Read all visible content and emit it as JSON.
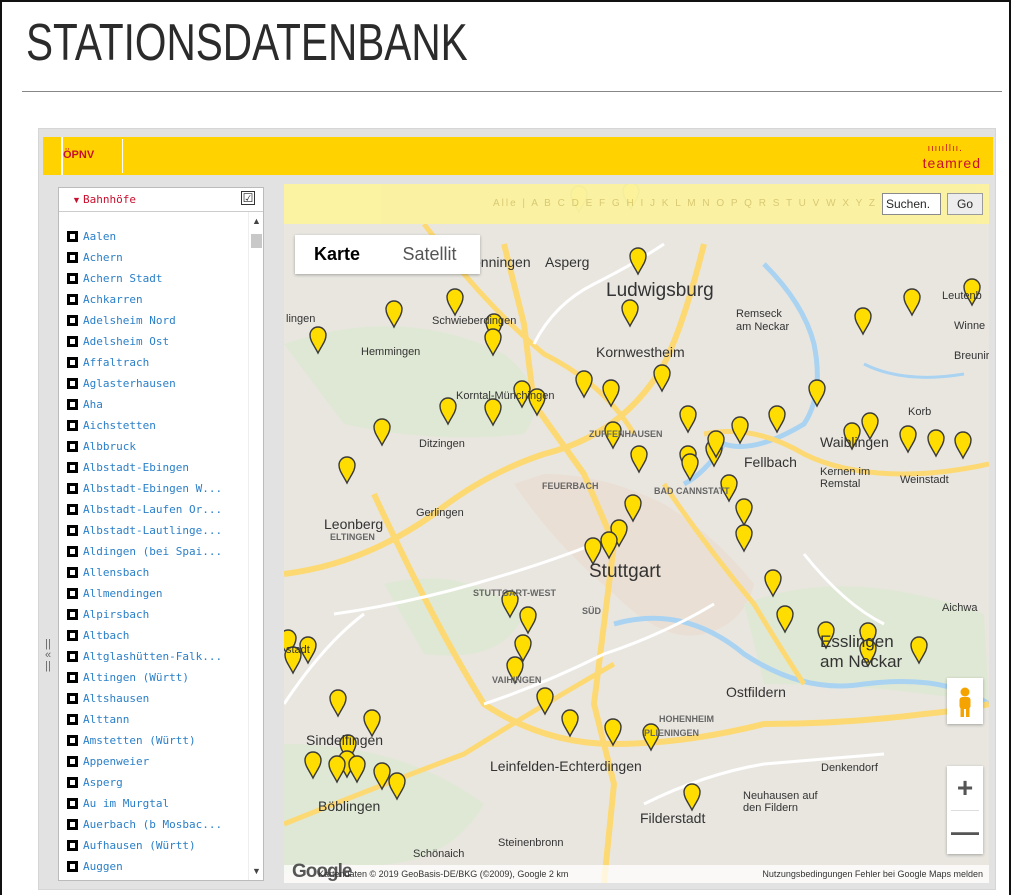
{
  "page": {
    "title": "STATIONSDATENBANK"
  },
  "topbar": {
    "tab_label": "ÖPNV",
    "logo_wave": "ıııııllıı.",
    "logo_brand": "teamred"
  },
  "sidebar": {
    "dropdown_label": "Bahnhöfe",
    "checkbox": "☑",
    "collapse": "||\n«\n||",
    "items": [
      "Aalen",
      "Achern",
      "Achern Stadt",
      "Achkarren",
      "Adelsheim Nord",
      "Adelsheim Ost",
      "Affaltrach",
      "Aglasterhausen",
      "Aha",
      "Aichstetten",
      "Albbruck",
      "Albstadt-Ebingen",
      "Albstadt-Ebingen W...",
      "Albstadt-Laufen Or...",
      "Albstadt-Lautlinge...",
      "Aldingen (bei Spai...",
      "Allensbach",
      "Allmendingen",
      "Alpirsbach",
      "Altbach",
      "Altglashütten-Falk...",
      "Altingen (Württ)",
      "Altshausen",
      "Alttann",
      "Amstetten (Württ)",
      "Appenweier",
      "Asperg",
      "Au im Murgtal",
      "Auerbach (b Mosbac...",
      "Aufhausen (Württ)",
      "Auggen"
    ]
  },
  "filter": {
    "alphabet": "Alle | A B C D E F G H I J K L M N O P Q R S T U V W X Y Z",
    "search_value": "Suchen.",
    "go_label": "Go"
  },
  "map": {
    "type_map": "Karte",
    "type_satellite": "Satellit",
    "zoom_in": "+",
    "zoom_out": "—",
    "google": "Google",
    "copyright": "Kartendaten © 2019 GeoBasis-DE/BKG (©2009), Google   2 km",
    "terms": "Nutzungsbedingungen   Fehler bei Google Maps melden",
    "places": {
      "ludwigsburg": "Ludwigsburg",
      "asperg": "Asperg",
      "boeningen": "önningen",
      "schwieberdingen": "Schwieberdingen",
      "hemmingen": "Hemmingen",
      "kornwestheim": "Kornwestheim",
      "remseck": "Remseck\nam Neckar",
      "korntal": "Korntal-Münchingen",
      "leutenb": "Leutenb",
      "winne": "Winne",
      "breunin": "Breunir",
      "korb": "Korb",
      "waiblingen": "Waiblingen",
      "fellbach": "Fellbach",
      "kernen": "Kernen im\nRemstal",
      "weinstadt": "Weinstadt",
      "ditzingen": "Ditzingen",
      "gerlingen": "Gerlingen",
      "leonberg": "Leonberg",
      "eltingen": "ELTINGEN",
      "stuttgart": "Stuttgart",
      "stuttgart_west": "STUTTGART-WEST",
      "sued": "SÜD",
      "bad_cannstatt": "BAD CANNSTATT",
      "feuerbach": "FEUERBACH",
      "zuffenhausen": "ZUFFENHAUSEN",
      "lingen": "lingen",
      "aichwa": "Aichwa",
      "esslingen": "Esslingen\nam Neckar",
      "ostfildern": "Ostfildern",
      "stadt": "stadt",
      "vaihingen": "VAIHINGEN",
      "hohenheim": "HOHENHEIM",
      "plieningen": "PLIENINGEN",
      "sindelfingen": "Sindelfingen",
      "leinfelden": "Leinfelden-Echterdingen",
      "denkendorf": "Denkendorf",
      "neuhausen": "Neuhausen auf\nden Fildern",
      "boeblingen": "Böblingen",
      "filderstadt": "Filderstadt",
      "schoenaich": "Schönaich",
      "steinenbronn": "Steinenbronn"
    }
  },
  "colors": {
    "brand_yellow": "#ffd200",
    "brand_red": "#c8102e",
    "marker": "#ffdd00",
    "link": "#2a7fc8"
  }
}
